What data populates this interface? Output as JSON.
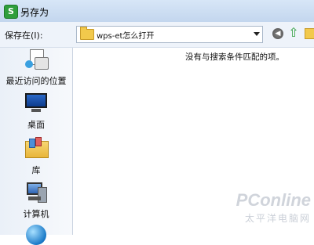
{
  "window": {
    "title": "另存为",
    "app_icon": "S"
  },
  "toolbar": {
    "save_in_label": "保存在(I):",
    "path_value": "wps-et怎么打开",
    "icons": [
      "back-icon",
      "up-folder-icon",
      "new-folder-icon"
    ]
  },
  "sidebar": {
    "items": [
      {
        "label": "最近访问的位置",
        "icon": "recent-places-icon"
      },
      {
        "label": "桌面",
        "icon": "desktop-icon"
      },
      {
        "label": "库",
        "icon": "libraries-icon"
      },
      {
        "label": "计算机",
        "icon": "computer-icon"
      },
      {
        "label": "",
        "icon": "network-icon"
      }
    ]
  },
  "filepane": {
    "empty_message": "没有与搜索条件匹配的项。"
  },
  "watermark": {
    "logo": "PConline",
    "sub": "太平洋电脑网"
  },
  "colors": {
    "titlebar": "#c3d6ee",
    "accent_green": "#2e9e3c",
    "folder": "#f2c94c"
  }
}
